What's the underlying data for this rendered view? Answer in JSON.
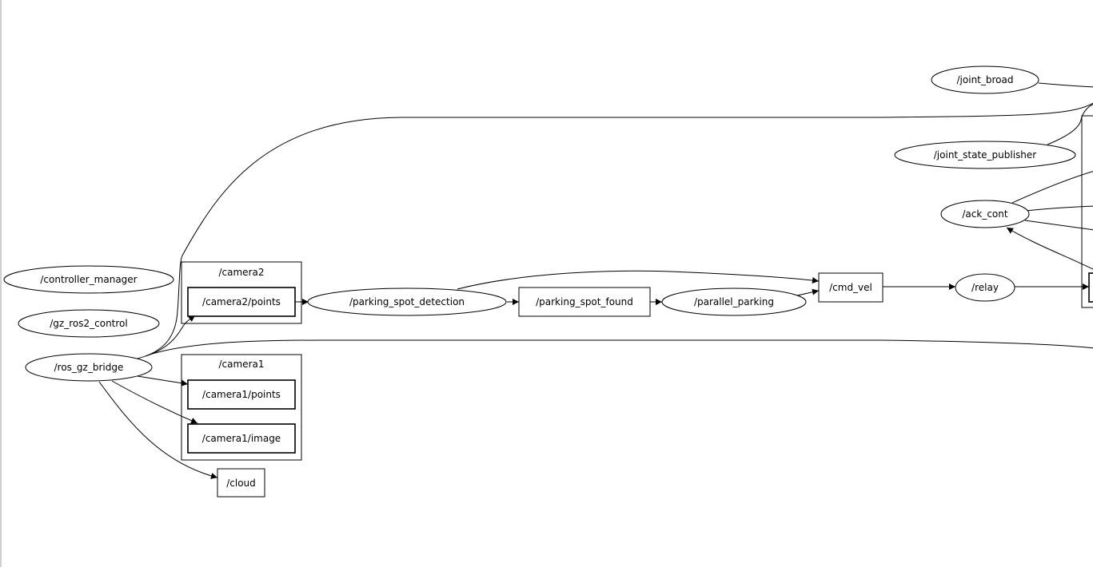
{
  "graph": {
    "nodes": {
      "controller_manager": "/controller_manager",
      "gz_ros2_control": "/gz_ros2_control",
      "ros_gz_bridge": "/ros_gz_bridge",
      "parking_spot_detection": "/parking_spot_detection",
      "parallel_parking": "/parallel_parking",
      "joint_broad": "/joint_broad",
      "joint_state_publisher": "/joint_state_publisher",
      "ack_cont": "/ack_cont",
      "relay": "/relay"
    },
    "topics": {
      "camera2_points": "/camera2/points",
      "camera1_points": "/camera1/points",
      "camera1_image": "/camera1/image",
      "cloud": "/cloud",
      "parking_spot_found": "/parking_spot_found",
      "cmd_vel": "/cmd_vel"
    },
    "clusters": {
      "camera2": "/camera2",
      "camera1": "/camera1"
    }
  }
}
